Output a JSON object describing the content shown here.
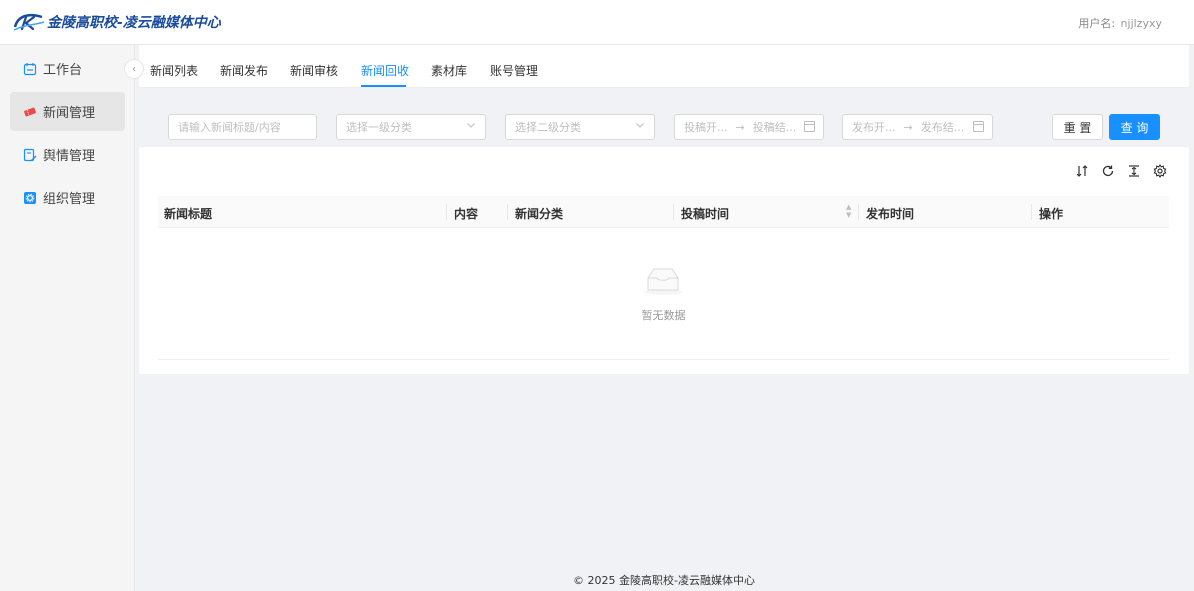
{
  "header": {
    "logo_text": "金陵高职校-凌云融媒体中心",
    "user_label": "用户名:",
    "username": "njjlzyxy"
  },
  "sidebar": {
    "items": [
      {
        "label": "工作台",
        "icon": "calendar-icon",
        "active": false
      },
      {
        "label": "新闻管理",
        "icon": "ticket-icon",
        "active": true
      },
      {
        "label": "舆情管理",
        "icon": "edit-document-icon",
        "active": false
      },
      {
        "label": "组织管理",
        "icon": "gear-badge-icon",
        "active": false
      }
    ],
    "collapse_glyph": "‹"
  },
  "tabs": [
    {
      "label": "新闻列表"
    },
    {
      "label": "新闻发布"
    },
    {
      "label": "新闻审核"
    },
    {
      "label": "新闻回收",
      "active": true
    },
    {
      "label": "素材库"
    },
    {
      "label": "账号管理"
    }
  ],
  "filters": {
    "search_placeholder": "请输入新闻标题/内容",
    "category1_placeholder": "选择一级分类",
    "category2_placeholder": "选择二级分类",
    "submit_start": "投稿开...",
    "submit_end": "投稿结...",
    "publish_start": "发布开...",
    "publish_end": "发布结...",
    "range_sep": "→",
    "reset_label": "重 置",
    "query_label": "查 询"
  },
  "table": {
    "columns": [
      "新闻标题",
      "内容",
      "新闻分类",
      "投稿时间",
      "发布时间",
      "操作"
    ],
    "rows": [],
    "empty_text": "暂无数据"
  },
  "toolbar": [
    "column-height-icon",
    "reload-icon",
    "density-icon",
    "settings-icon"
  ],
  "footer": {
    "text": "© 2025 金陵高职校-凌云融媒体中心"
  },
  "colors": {
    "accent": "#1890ff",
    "logo": "#1a4b9c"
  }
}
